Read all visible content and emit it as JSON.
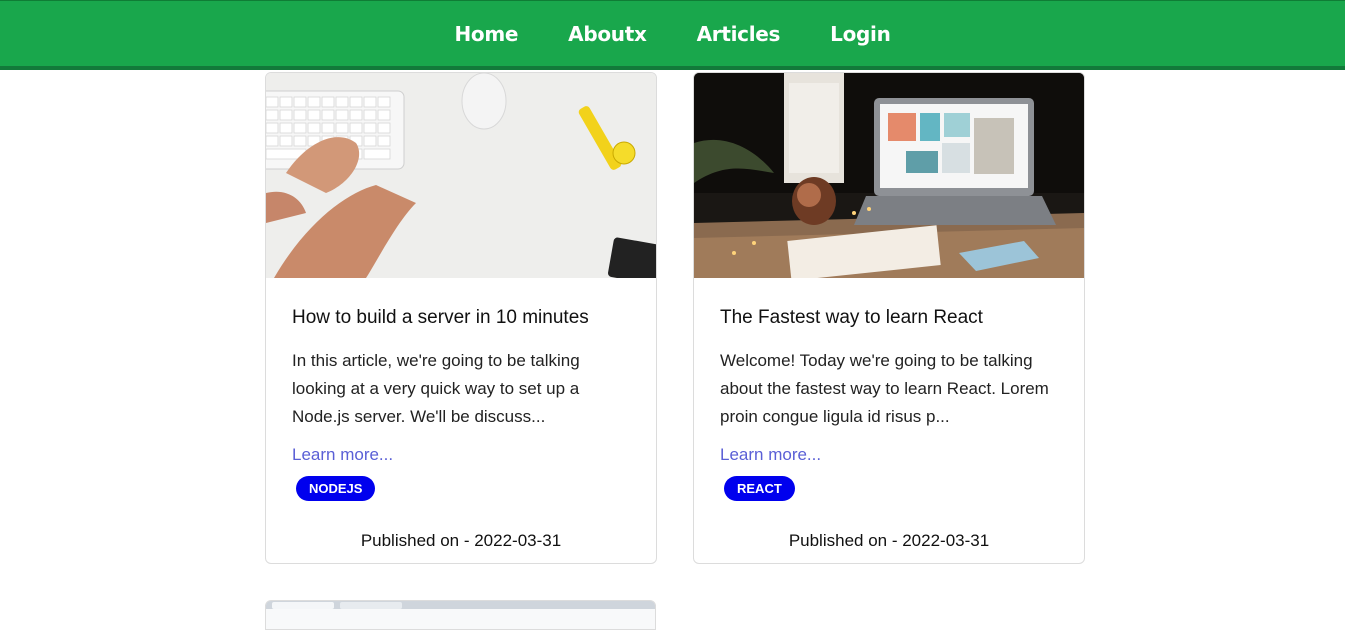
{
  "nav": {
    "items": [
      {
        "label": "Home"
      },
      {
        "label": "Aboutx"
      },
      {
        "label": "Articles"
      },
      {
        "label": "Login"
      }
    ]
  },
  "articles": [
    {
      "title": "How to build a server in 10 minutes",
      "excerpt": "In this article, we're going to be talking looking at a very quick way to set up a Node.js server. We'll be discuss...",
      "learn_more": "Learn more...",
      "tag": "NODEJS",
      "published": "Published on - 2022-03-31"
    },
    {
      "title": "The Fastest way to learn React",
      "excerpt": "Welcome! Today we're going to be talking about the fastest way to learn React. Lorem proin congue ligula id risus p...",
      "learn_more": "Learn more...",
      "tag": "REACT",
      "published": "Published on - 2022-03-31"
    }
  ],
  "colors": {
    "navbar": "#19a74c",
    "link": "#5a5fd6",
    "tag": "#0000ee"
  }
}
